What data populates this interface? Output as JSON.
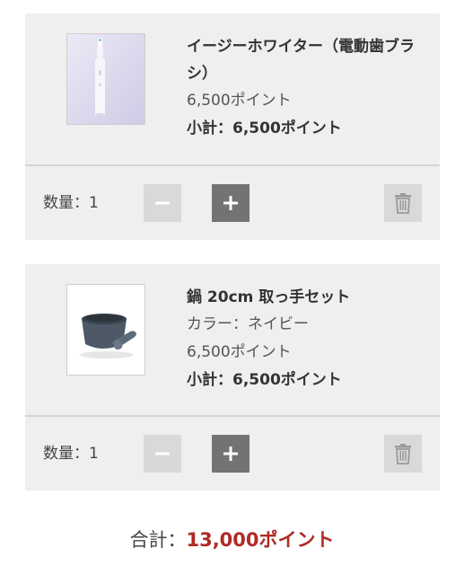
{
  "cart": {
    "items": [
      {
        "name": "イージーホワイター（電動歯ブラシ）",
        "option": "",
        "price": "6,500ポイント",
        "subtotal": "小計：6,500ポイント",
        "quantity_label": "数量：1",
        "image_icon": "electric-toothbrush-image"
      },
      {
        "name": "鍋 20cm 取っ手セット",
        "option": "カラー：ネイビー",
        "price": "6,500ポイント",
        "subtotal": "小計：6,500ポイント",
        "quantity_label": "数量：1",
        "image_icon": "pot-with-handle-image"
      }
    ],
    "controls": {
      "minus_icon": "minus-icon",
      "plus_icon": "plus-icon",
      "trash_icon": "trash-icon"
    },
    "total_label": "合計：",
    "total_value": "13,000ポイント"
  },
  "colors": {
    "card_background": "#efefef",
    "plus_button": "#737373",
    "disabled_button": "#d9d9d9",
    "total_accent": "#b02a25"
  }
}
